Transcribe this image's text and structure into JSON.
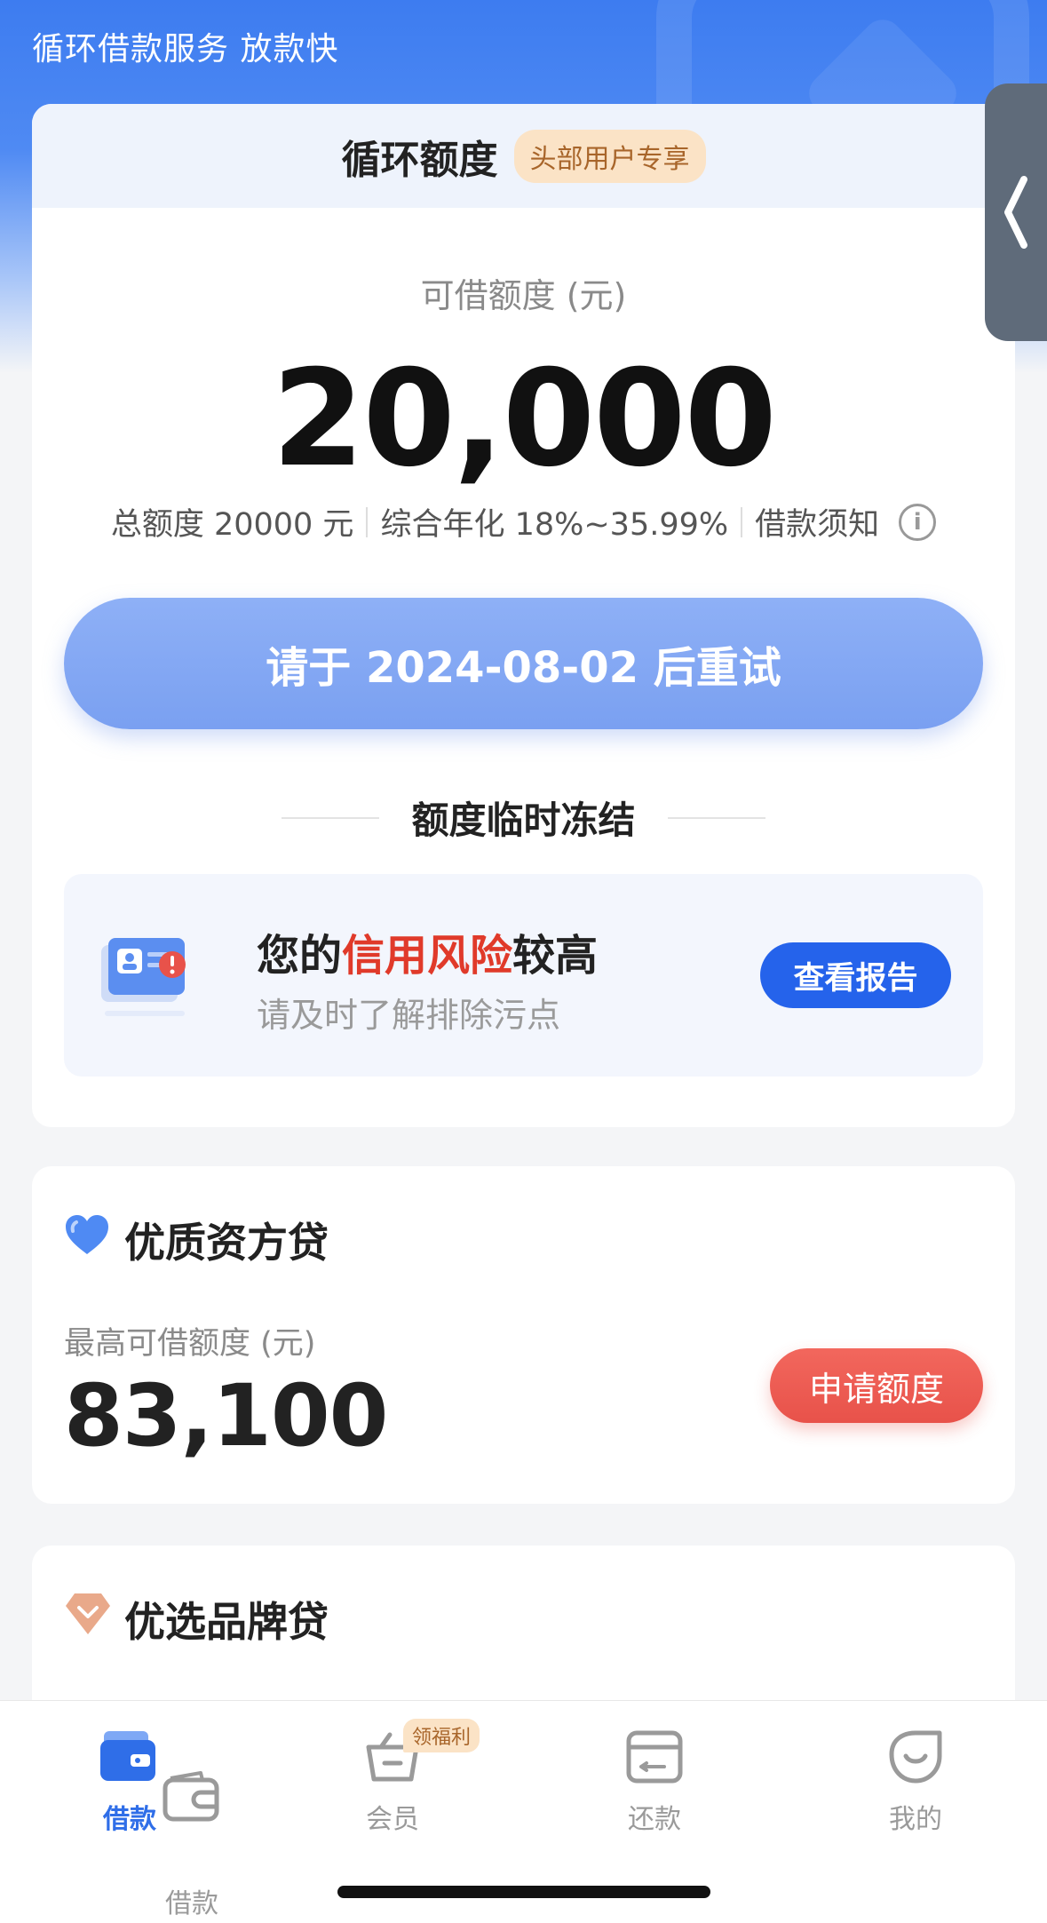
{
  "header": {
    "title": "循环借款服务 放款快"
  },
  "credit_card": {
    "title": "循环额度",
    "badge": "头部用户专享",
    "available_label": "可借额度 (元)",
    "available_amount": "20,000",
    "total_quota": "总额度 20000 元",
    "annual_rate": "综合年化 18%~35.99%",
    "notice": "借款须知",
    "retry_button": "请于 2024-08-02 后重试",
    "frozen_title": "额度临时冻结",
    "risk": {
      "title_prefix": "您的",
      "title_highlight": "信用风险",
      "title_suffix": "较高",
      "subtitle": "请及时了解排除污点",
      "report_button": "查看报告"
    }
  },
  "quality_loan": {
    "title": "优质资方贷",
    "max_label": "最高可借额度 (元)",
    "amount": "83,100",
    "apply_button": "申请额度"
  },
  "brand_loan": {
    "title": "优选品牌贷"
  },
  "tabbar": {
    "items": [
      {
        "label": "借款",
        "active": true
      },
      {
        "label": "会员",
        "badge": "领福利"
      },
      {
        "label": "还款"
      },
      {
        "label": "我的"
      }
    ]
  },
  "floating_wallet": {
    "label": "借款"
  },
  "colors": {
    "brand_blue": "#2f6ee8",
    "risk_red": "#e03a2a",
    "apply_red": "#e8524a",
    "badge_bg": "#fbe3c6"
  }
}
